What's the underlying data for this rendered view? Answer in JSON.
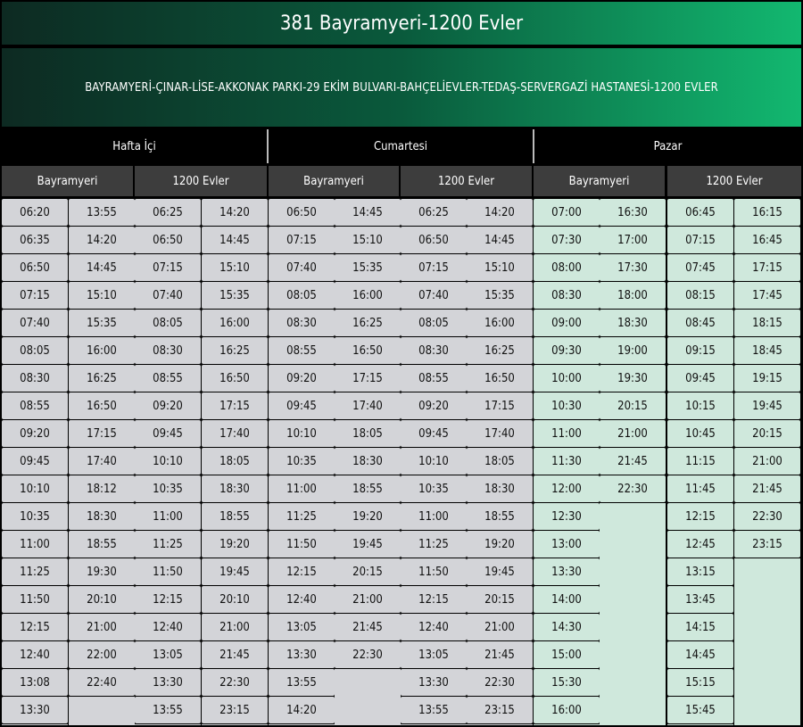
{
  "title": "381 Bayramyeri-1200 Evler",
  "route": "BAYRAMYERİ-ÇINAR-LİSE-AKKONAK PARKI-29 EKİM BULVARI-BAHÇELİEVLER-TEDAŞ-SERVERGAZİ HASTANESİ-1200 EVLER",
  "colors": {
    "weekday_cells": "#d3d4d8",
    "weekend_cells": "#cfe8dc",
    "header": "#3d3d3d"
  },
  "days": [
    {
      "name": "Hafta İçi",
      "directions": [
        {
          "name": "Bayramyeri",
          "columns": [
            [
              "06:20",
              "06:35",
              "06:50",
              "07:15",
              "07:40",
              "08:05",
              "08:30",
              "08:55",
              "09:20",
              "09:45",
              "10:10",
              "10:35",
              "11:00",
              "11:25",
              "11:50",
              "12:15",
              "12:40",
              "13:08",
              "13:30"
            ],
            [
              "13:55",
              "14:20",
              "14:45",
              "15:10",
              "15:35",
              "16:00",
              "16:25",
              "16:50",
              "17:15",
              "17:40",
              "18:12",
              "18:30",
              "18:55",
              "19:30",
              "20:10",
              "21:00",
              "22:00",
              "22:40"
            ]
          ]
        },
        {
          "name": "1200 Evler",
          "columns": [
            [
              "06:25",
              "06:50",
              "07:15",
              "07:40",
              "08:05",
              "08:30",
              "08:55",
              "09:20",
              "09:45",
              "10:10",
              "10:35",
              "11:00",
              "11:25",
              "11:50",
              "12:15",
              "12:40",
              "13:05",
              "13:30",
              "13:55"
            ],
            [
              "14:20",
              "14:45",
              "15:10",
              "15:35",
              "16:00",
              "16:25",
              "16:50",
              "17:15",
              "17:40",
              "18:05",
              "18:30",
              "18:55",
              "19:20",
              "19:45",
              "20:10",
              "21:00",
              "21:45",
              "22:30",
              "23:15"
            ]
          ]
        }
      ]
    },
    {
      "name": "Cumartesi",
      "directions": [
        {
          "name": "Bayramyeri",
          "columns": [
            [
              "06:50",
              "07:15",
              "07:40",
              "08:05",
              "08:30",
              "08:55",
              "09:20",
              "09:45",
              "10:10",
              "10:35",
              "11:00",
              "11:25",
              "11:50",
              "12:15",
              "12:40",
              "13:05",
              "13:30",
              "13:55",
              "14:20"
            ],
            [
              "14:45",
              "15:10",
              "15:35",
              "16:00",
              "16:25",
              "16:50",
              "17:15",
              "17:40",
              "18:05",
              "18:30",
              "18:55",
              "19:20",
              "19:45",
              "20:15",
              "21:00",
              "21:45",
              "22:30"
            ]
          ]
        },
        {
          "name": "1200 Evler",
          "columns": [
            [
              "06:25",
              "06:50",
              "07:15",
              "07:40",
              "08:05",
              "08:30",
              "08:55",
              "09:20",
              "09:45",
              "10:10",
              "10:35",
              "11:00",
              "11:25",
              "11:50",
              "12:15",
              "12:40",
              "13:05",
              "13:30",
              "13:55"
            ],
            [
              "14:20",
              "14:45",
              "15:10",
              "15:35",
              "16:00",
              "16:25",
              "16:50",
              "17:15",
              "17:40",
              "18:05",
              "18:30",
              "18:55",
              "19:20",
              "19:45",
              "20:15",
              "21:00",
              "21:45",
              "22:30",
              "23:15"
            ]
          ]
        }
      ]
    },
    {
      "name": "Pazar",
      "directions": [
        {
          "name": "Bayramyeri",
          "columns": [
            [
              "07:00",
              "07:30",
              "08:00",
              "08:30",
              "09:00",
              "09:30",
              "10:00",
              "10:30",
              "11:00",
              "11:30",
              "12:00",
              "12:30",
              "13:00",
              "13:30",
              "14:00",
              "14:30",
              "15:00",
              "15:30",
              "16:00"
            ],
            [
              "16:30",
              "17:00",
              "17:30",
              "18:00",
              "18:30",
              "19:00",
              "19:30",
              "20:15",
              "21:00",
              "21:45",
              "22:30"
            ]
          ]
        },
        {
          "name": "1200 Evler",
          "columns": [
            [
              "06:45",
              "07:15",
              "07:45",
              "08:15",
              "08:45",
              "09:15",
              "09:45",
              "10:15",
              "10:45",
              "11:15",
              "11:45",
              "12:15",
              "12:45",
              "13:15",
              "13:45",
              "14:15",
              "14:45",
              "15:15",
              "15:45"
            ],
            [
              "16:15",
              "16:45",
              "17:15",
              "17:45",
              "18:15",
              "18:45",
              "19:15",
              "19:45",
              "20:15",
              "21:00",
              "21:45",
              "22:30",
              "23:15"
            ]
          ]
        }
      ]
    }
  ]
}
